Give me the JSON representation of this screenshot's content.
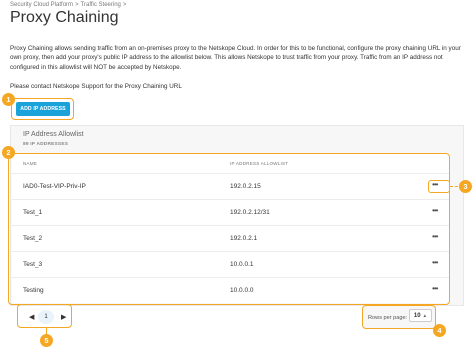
{
  "breadcrumb": {
    "parent": "Security Cloud Platform",
    "separator": ">",
    "current": "Traffic Steering",
    "end": ">"
  },
  "page_title": "Proxy Chaining",
  "description": "Proxy Chaining allows sending traffic from an on-premises proxy to the Netskope Cloud. In order for this to be functional, configure the proxy chaining URL in your own proxy, then add your proxy's public IP address to the allowlist below. This allows Netskope to trust traffic from your proxy. Traffic from an IP address not configured in this allowlist will NOT be accepted by Netskope.",
  "contact_text": "Please contact Netskope Support for the Proxy Chaining URL",
  "add_button_label": "ADD IP ADDRESS",
  "panel": {
    "title": "IP Address Allowlist",
    "subtitle": "89 IP ADDRESSES"
  },
  "table": {
    "headers": [
      "NAME",
      "IP ADDRESS ALLOWLIST"
    ],
    "rows": [
      {
        "name": "IAD0-Test-VIP-Priv-IP",
        "ip": "192.0.2.15",
        "more": "•••"
      },
      {
        "name": "Test_1",
        "ip": "192.0.2.12/31",
        "more": "•••"
      },
      {
        "name": "Test_2",
        "ip": "192.0.2.1",
        "more": "•••"
      },
      {
        "name": "Test_3",
        "ip": "10.0.0.1",
        "more": "•••"
      },
      {
        "name": "Testing",
        "ip": "10.0.0.0",
        "more": "•••"
      }
    ]
  },
  "pagination": {
    "prev": "◀",
    "next": "▶",
    "current_page": "1"
  },
  "rows_per_page": {
    "label": "Rows per page:",
    "value": "10",
    "caret": "▲"
  },
  "callouts": [
    "1",
    "2",
    "3",
    "4",
    "5"
  ],
  "colors": {
    "accent": "#1aa3db",
    "callout": "#f5a623"
  }
}
